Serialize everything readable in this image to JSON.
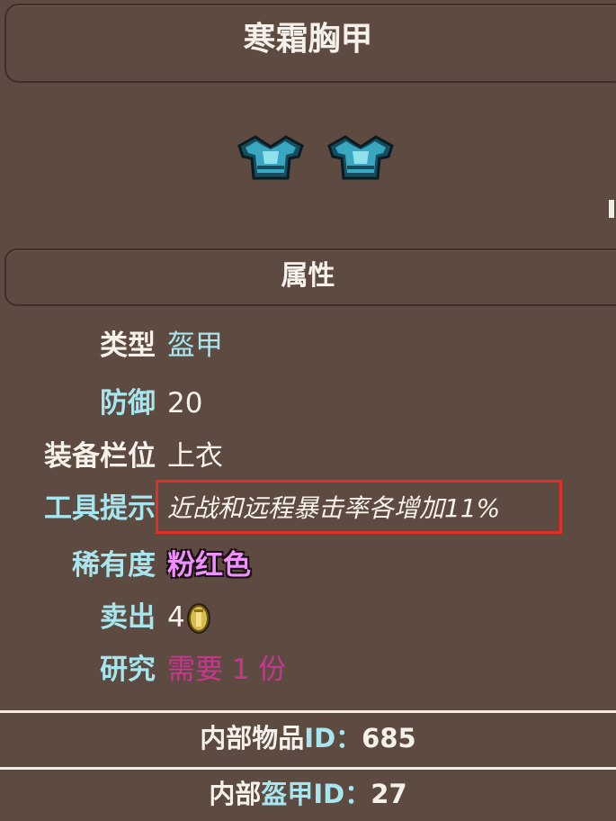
{
  "title": "寒霜胸甲",
  "section_header": "属性",
  "icons": [
    {
      "name": "frost-breastplate-icon"
    },
    {
      "name": "frost-breastplate-icon"
    },
    {
      "name": "gold-coin-icon"
    }
  ],
  "properties": {
    "type_label": "类型",
    "type_value": "盔甲",
    "defense_label": "防御",
    "defense_value": "20",
    "slot_label": "装备栏位",
    "slot_value": "上衣",
    "tooltip_label": "工具提示",
    "tooltip_value": "近战和远程暴击率各增加11%",
    "rarity_label": "稀有度",
    "rarity_value": "粉红色",
    "sell_label": "卖出",
    "sell_value": "4",
    "research_label": "研究",
    "research_value": "需要 1 份"
  },
  "footer": {
    "item_id_prefix": "内部物品",
    "item_id_key": "ID：",
    "item_id_value": "685",
    "armor_id_prefix": "内部",
    "armor_id_mid": "盔甲",
    "armor_id_key": "ID：",
    "armor_id_value": "27"
  },
  "colors": {
    "background": "#5d4a41",
    "label_cyan": "#a8e6ef",
    "text_white": "#f7f1eb",
    "rarity_pink": "#ee91ff",
    "research_magenta": "#c8378f",
    "highlight_red": "#e12f25"
  }
}
